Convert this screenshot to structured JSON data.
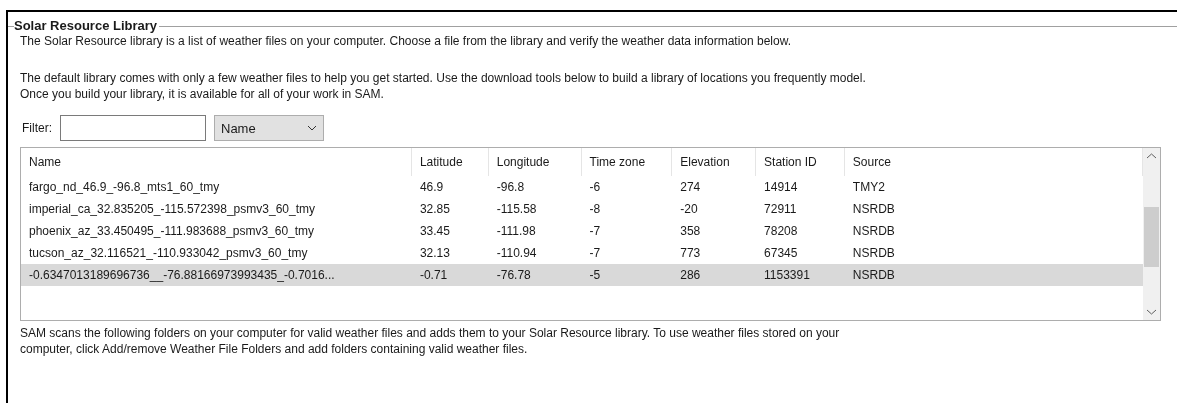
{
  "group_title": "Solar Resource Library",
  "intro": [
    "The Solar Resource library is a list of weather files on your computer. Choose a file from the library and verify the weather data information below.",
    "The default library comes with only a few weather files to help you get started. Use the download tools below to build a library of locations you frequently model.\nOnce you build your library, it is available for all of your work in SAM."
  ],
  "filter": {
    "label": "Filter:",
    "dropdown": "Name"
  },
  "table": {
    "columns": [
      "Name",
      "Latitude",
      "Longitude",
      "Time zone",
      "Elevation",
      "Station ID",
      "Source"
    ],
    "rows": [
      {
        "cells": [
          "fargo_nd_46.9_-96.8_mts1_60_tmy",
          "46.9",
          "-96.8",
          "-6",
          "274",
          "14914",
          "TMY2"
        ],
        "selected": false
      },
      {
        "cells": [
          "imperial_ca_32.835205_-115.572398_psmv3_60_tmy",
          "32.85",
          "-115.58",
          "-8",
          "-20",
          "72911",
          "NSRDB"
        ],
        "selected": false
      },
      {
        "cells": [
          "phoenix_az_33.450495_-111.983688_psmv3_60_tmy",
          "33.45",
          "-111.98",
          "-7",
          "358",
          "78208",
          "NSRDB"
        ],
        "selected": false
      },
      {
        "cells": [
          "tucson_az_32.116521_-110.933042_psmv3_60_tmy",
          "32.13",
          "-110.94",
          "-7",
          "773",
          "67345",
          "NSRDB"
        ],
        "selected": false
      },
      {
        "cells": [
          "-0.6347013189696736__-76.88166973993435_-0.7016...",
          "-0.71",
          "-76.78",
          "-5",
          "286",
          "1153391",
          "NSRDB"
        ],
        "selected": true
      }
    ]
  },
  "footer": "SAM scans the following folders on your computer for valid weather files and adds them to your Solar Resource library. To use weather files stored on your\ncomputer, click Add/remove Weather File Folders and add folders containing valid weather files."
}
